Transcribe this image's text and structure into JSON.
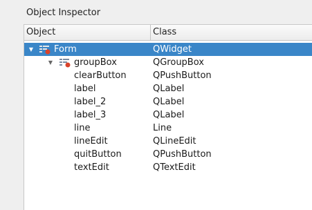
{
  "panel": {
    "title": "Object Inspector"
  },
  "columns": {
    "object": "Object",
    "class": "Class"
  },
  "rows": [
    {
      "name": "Form",
      "class": "QWidget"
    },
    {
      "name": "groupBox",
      "class": "QGroupBox"
    },
    {
      "name": "clearButton",
      "class": "QPushButton"
    },
    {
      "name": "label",
      "class": "QLabel"
    },
    {
      "name": "label_2",
      "class": "QLabel"
    },
    {
      "name": "label_3",
      "class": "QLabel"
    },
    {
      "name": "line",
      "class": "Line"
    },
    {
      "name": "lineEdit",
      "class": "QLineEdit"
    },
    {
      "name": "quitButton",
      "class": "QPushButton"
    },
    {
      "name": "textEdit",
      "class": "QTextEdit"
    }
  ],
  "colors": {
    "selection": "#3a86c8",
    "icon_badge": "#d9432b"
  },
  "icons": {
    "expand": "expand-arrow-icon",
    "widget": "widget-tree-icon"
  }
}
